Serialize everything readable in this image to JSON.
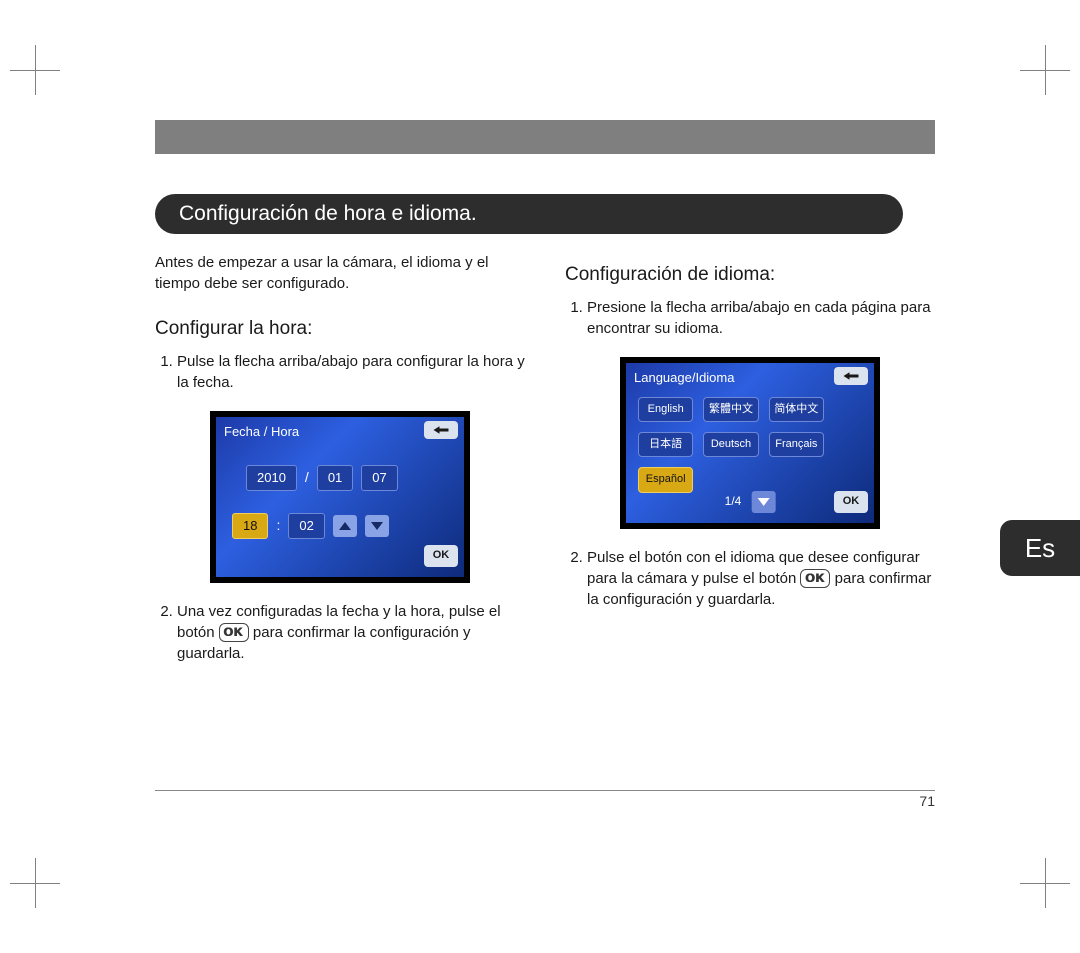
{
  "section_title": "Configuración de hora e idioma.",
  "intro": "Antes de empezar a usar la cámara, el idioma y el tiempo debe ser configurado.",
  "left": {
    "subhead": "Configurar la hora:",
    "step1": "Pulse la flecha arriba/abajo para configurar la hora y la fecha.",
    "step2_a": "Una vez configuradas la fecha y la hora, pulse el botón ",
    "step2_b": " para confirmar la configuración y guardarla."
  },
  "right": {
    "subhead": "Configuración de idioma:",
    "step1": "Presione la flecha arriba/abajo en cada página para encontrar su idioma.",
    "step2_a": "Pulse el botón con el idioma que desee configurar para la cámara y pulse el botón ",
    "step2_b": " para confirmar la configuración y guardarla."
  },
  "ok_label": "OK",
  "screen_time": {
    "title": "Fecha / Hora",
    "year": "2010",
    "month": "01",
    "day": "07",
    "hour": "18",
    "minute": "02",
    "ok": "OK"
  },
  "screen_lang": {
    "title": "Language/Idioma",
    "langs": [
      "English",
      "繁體中文",
      "简体中文",
      "日本語",
      "Deutsch",
      "Français",
      "Español"
    ],
    "pager": "1/4",
    "ok": "OK"
  },
  "side_tab": "Es",
  "page_number": "71"
}
